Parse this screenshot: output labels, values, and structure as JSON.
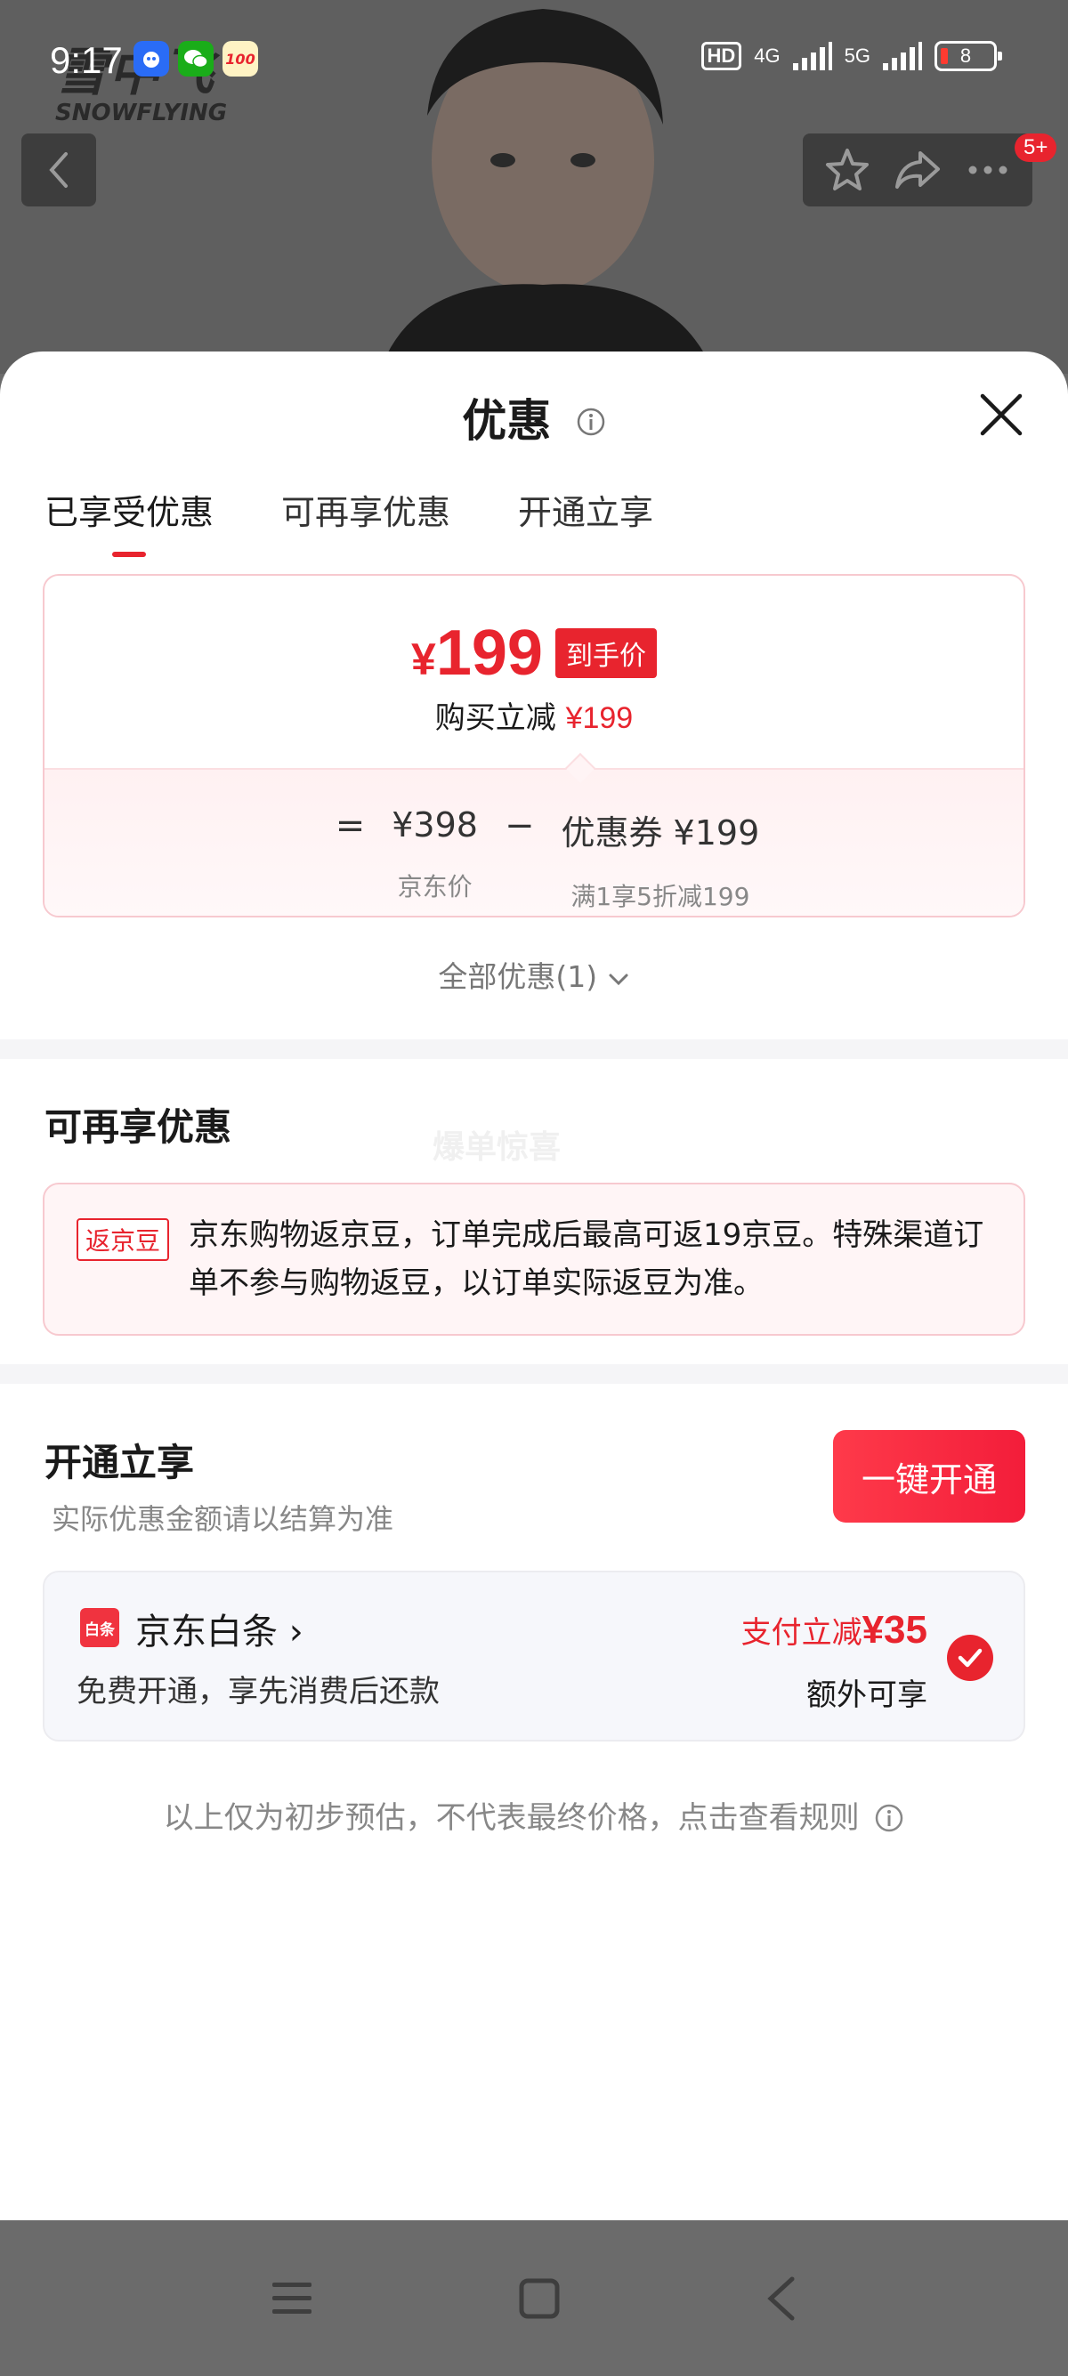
{
  "status_bar": {
    "time": "9:17",
    "network_hd": "HD",
    "network_4g": "4G",
    "network_5g": "5G",
    "battery": "8",
    "app_icons": [
      "baidu-icon",
      "wechat-icon",
      "score-100-icon"
    ],
    "app_100": "100"
  },
  "background": {
    "brand_cn": "雪中飞",
    "brand_en": "SNOWFLYING",
    "notification_badge": "5+"
  },
  "sheet": {
    "title": "优惠",
    "tabs": [
      {
        "label": "已享受优惠",
        "active": true
      },
      {
        "label": "可再享优惠",
        "active": false
      },
      {
        "label": "开通立享",
        "active": false
      }
    ],
    "price_card": {
      "currency": "¥",
      "final_price": "199",
      "final_tag": "到手价",
      "save_label": "购买立减",
      "save_amount": "¥199",
      "equals": "=",
      "jd_price": "¥398",
      "jd_price_label": "京东价",
      "minus": "−",
      "coupon": "优惠券 ¥199",
      "coupon_rule": "满1享5折减199"
    },
    "all_deals": "全部优惠(1)",
    "more_section": {
      "title": "可再享优惠",
      "watermark": "爆单惊喜",
      "bean_tag": "返京豆",
      "bean_text": "京东购物返京豆，订单完成后最高可返19京豆。特殊渠道订单不参与购物返豆，以订单实际返豆为准。"
    },
    "open_section": {
      "title": "开通立享",
      "subtitle": "实际优惠金额请以结算为准",
      "button": "一键开通",
      "baitiao": {
        "logo": "白条",
        "name": "京东白条 ›",
        "desc": "免费开通，享先消费后还款",
        "deal_label": "支付立减",
        "deal_amount": "¥35",
        "extra": "额外可享"
      }
    },
    "footnote": "以上仅为初步预估，不代表最终价格，点击查看规则"
  },
  "colors": {
    "accent": "#e8242e",
    "card_border": "#f7c9cf",
    "muted_text": "#888888"
  }
}
